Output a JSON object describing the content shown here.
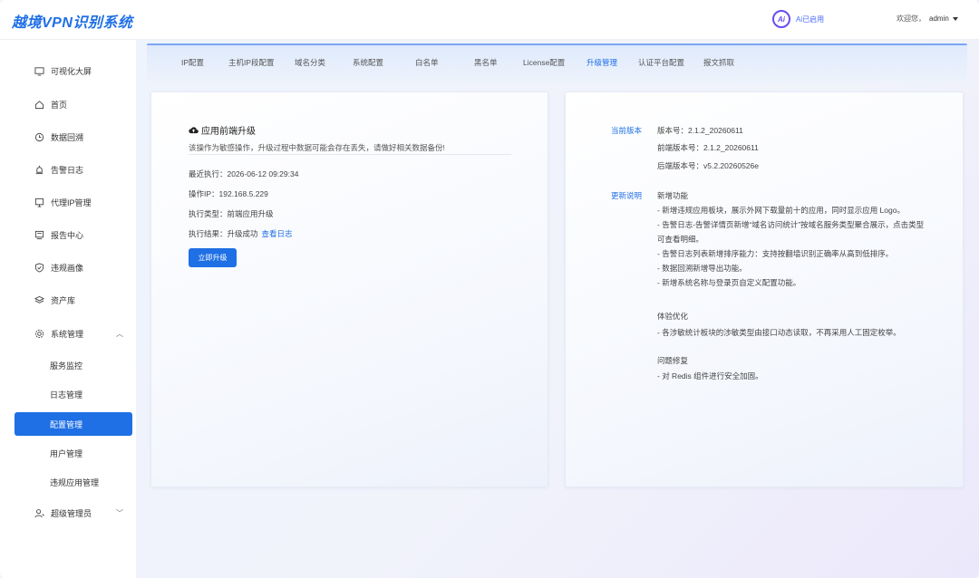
{
  "header": {
    "logo": "越境VPN识别系统",
    "ai_icon": "Ai",
    "ai_status": "Ai已启用",
    "welcome": "欢迎您，",
    "username": "admin"
  },
  "sidebar": {
    "items": [
      {
        "label": "可视化大屏",
        "icon": "monitor-icon"
      },
      {
        "label": "首页",
        "icon": "home-icon"
      },
      {
        "label": "数据回溯",
        "icon": "history-icon"
      },
      {
        "label": "告警日志",
        "icon": "alarm-icon"
      },
      {
        "label": "代理IP管理",
        "icon": "proxy-icon"
      },
      {
        "label": "报告中心",
        "icon": "report-icon"
      },
      {
        "label": "违规画像",
        "icon": "shield-icon"
      },
      {
        "label": "资产库",
        "icon": "layers-icon"
      },
      {
        "label": "系统管理",
        "icon": "settings-icon"
      }
    ],
    "system_sub": [
      {
        "label": "服务监控"
      },
      {
        "label": "日志管理"
      },
      {
        "label": "配置管理"
      },
      {
        "label": "用户管理"
      },
      {
        "label": "违规应用管理"
      }
    ],
    "super_admin": {
      "label": "超级管理员",
      "icon": "user-icon"
    }
  },
  "tabs": [
    "IP配置",
    "主机IP段配置",
    "域名分类",
    "系统配置",
    "白名单",
    "黑名单",
    "License配置",
    "升级管理",
    "认证平台配置",
    "报文抓取"
  ],
  "active_tab": "升级管理",
  "upgrade": {
    "title": "应用前端升级",
    "warning": "该操作为敏感操作，升级过程中数据可能会存在丢失，请做好相关数据备份!",
    "last_exec": "最近执行：2026-06-12 09:29:34",
    "operator_ip": "操作IP：192.168.5.229",
    "exec_type": "执行类型：前端应用升级",
    "exec_result": "执行结果：升级成功",
    "view_log": "查看日志",
    "button": "立即升级"
  },
  "version": {
    "current_label": "当前版本",
    "version": "版本号：2.1.2_20260611",
    "frontend": "前端版本号：2.1.2_20260611",
    "backend": "后端版本号：v5.2.20260526e",
    "changelog_label": "更新说明",
    "new_features_title": "新增功能",
    "new_features": [
      "- 新增违规应用板块，展示外网下载量前十的应用，同时显示应用 Logo。",
      "- 告警日志-告警详情页新增“域名访问统计”按域名服务类型聚合展示，点击类型",
      "可查看明细。",
      "- 告警日志列表新增排序能力：支持按翻墙识别正确率从高到低排序。",
      "- 数据回溯新增导出功能。",
      "- 新增系统名称与登录页自定义配置功能。"
    ],
    "ux_title": "体验优化",
    "ux": [
      "- 各涉敏统计板块的涉敏类型由接口动态读取，不再采用人工固定枚举。"
    ],
    "fix_title": "问题修复",
    "fixes": [
      "- 对 Redis 组件进行安全加固。"
    ]
  }
}
